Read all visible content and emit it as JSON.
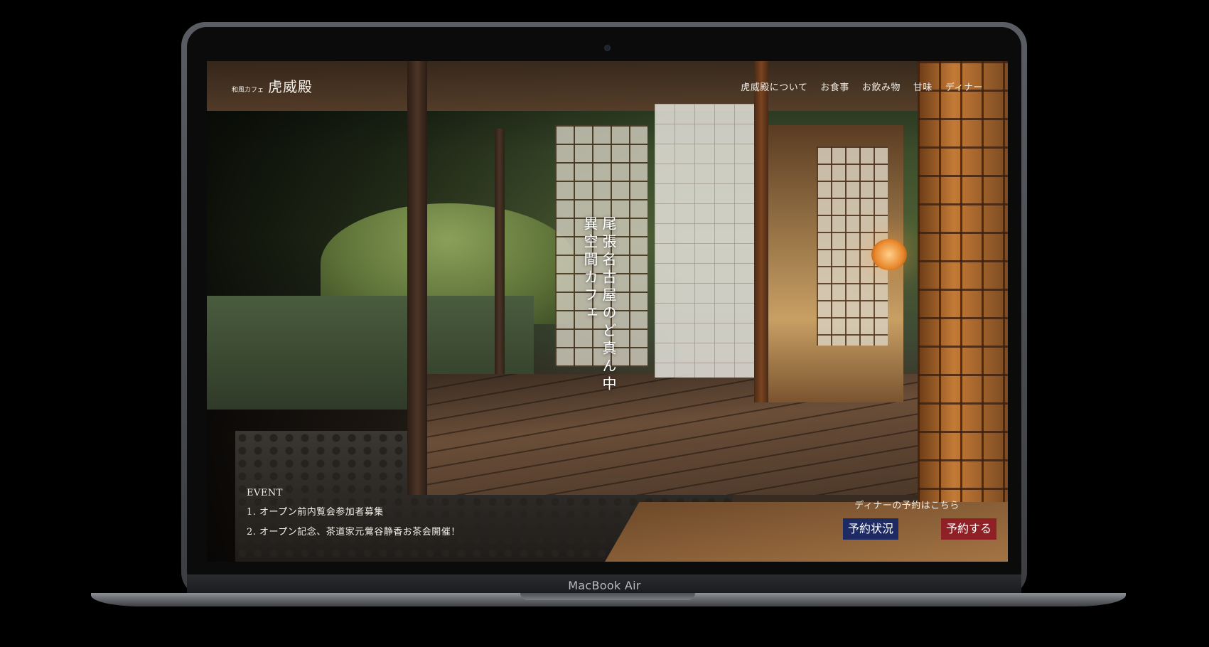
{
  "device": {
    "model_label": "MacBook Air"
  },
  "site": {
    "brand_tag": "和風カフェ",
    "brand_name": "虎威殿",
    "nav": [
      {
        "label": "虎威殿について"
      },
      {
        "label": "お食事"
      },
      {
        "label": "お飲み物"
      },
      {
        "label": "甘味"
      },
      {
        "label": "ディナー"
      }
    ],
    "tagline_line1": "尾張名古屋のど真ん中",
    "tagline_line2": "異空間カフェ",
    "event": {
      "heading": "EVENT",
      "items": [
        {
          "label": "1. オープン前内覧会参加者募集"
        },
        {
          "label": "2. オープン記念、茶道家元鶯谷静香お茶会開催！"
        }
      ]
    },
    "dinner": {
      "prompt": "ディナーの予約はこちら",
      "status_button": "予約状況",
      "reserve_button": "予約する"
    }
  },
  "colors": {
    "status_button_bg": "#1e2a63",
    "reserve_button_bg": "#8e2026",
    "text": "#f2efe8"
  }
}
